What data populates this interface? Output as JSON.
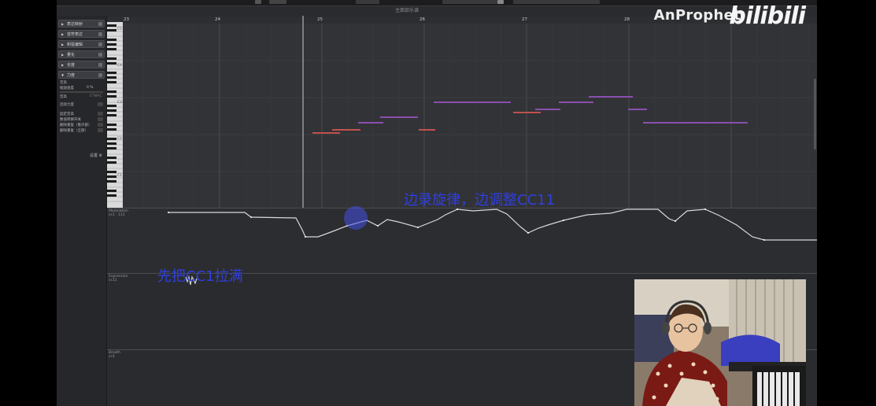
{
  "toolbar_title": "主面部乐谱",
  "sidebar": {
    "sections": [
      {
        "label": "表达映射"
      },
      {
        "label": "音符表达"
      },
      {
        "label": "和弦编辑"
      },
      {
        "label": "量化"
      },
      {
        "label": "长度"
      },
      {
        "label": "力度"
      }
    ],
    "props": [
      {
        "label": "音高"
      },
      {
        "label": "缩放速度",
        "value": "0 %"
      },
      {
        "label": "音高",
        "value": "ETMAC"
      },
      {
        "label": "连续力度"
      },
      {
        "label": "固定音高"
      },
      {
        "label": "数值转换开关"
      },
      {
        "label": "删除重复（重声部）"
      },
      {
        "label": "删除重复（全部）"
      }
    ],
    "settings_label": "设置"
  },
  "ruler": {
    "bars": [
      "23",
      "24",
      "25",
      "26",
      "27",
      "28"
    ]
  },
  "keyboard_labels": [
    "C5",
    "C4",
    "C3",
    "C2",
    "C1"
  ],
  "lanes": [
    {
      "name": "Modulation",
      "cc": "cc1 · 111"
    },
    {
      "name": "Expression",
      "cc": "cc11"
    },
    {
      "name": "Breath",
      "cc": "cc2"
    }
  ],
  "overlay": {
    "top_caption": "边录旋律，边调整CC11",
    "left_caption": "先把CC1拉满"
  },
  "watermark": {
    "channel": "AnProphet",
    "site": "bilibili"
  },
  "colors": {
    "note_purple": "#8a4fb0",
    "note_red": "#c0514f",
    "overlay_blue": "#2f3fe0"
  }
}
